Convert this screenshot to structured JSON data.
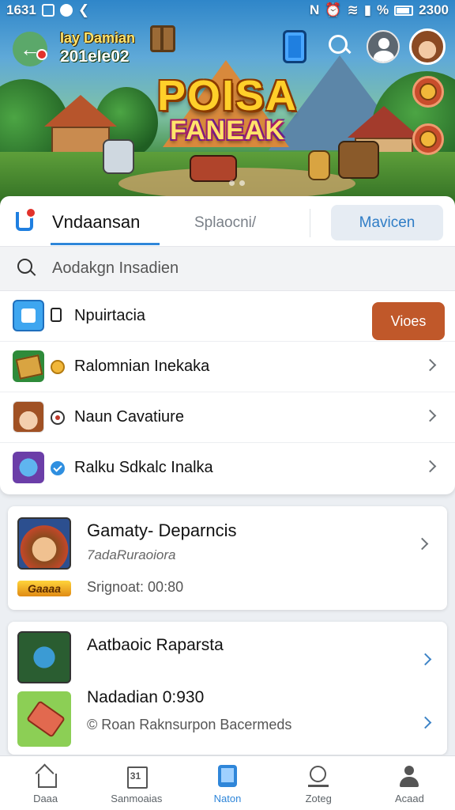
{
  "status_bar": {
    "time": "1631",
    "right_text": "2300"
  },
  "hero": {
    "title": "Iay Damian",
    "subtitle": "201eIe02",
    "logo_line1": "POISA",
    "logo_line2": "FANEAK",
    "icons": [
      "back-icon",
      "chest-icon",
      "phone-icon",
      "search-icon",
      "profile-icon",
      "avatar",
      "badge-icon"
    ]
  },
  "tabs": {
    "active": "Vndaansan",
    "inactive": "Splaocni/",
    "button": "Mavicen"
  },
  "search": {
    "placeholder": "Aodakgn Insadien"
  },
  "list": {
    "rows": [
      {
        "label": "Npuirtacia",
        "action": "Vioes"
      },
      {
        "label": "Ralomnian Inekaka"
      },
      {
        "label": "Naun Cavatiure"
      },
      {
        "label": "Ralku Sdkalc Inalka"
      }
    ]
  },
  "card2": {
    "title": "Gamaty- Deparncis",
    "subtitle": "7adaRuraoiora",
    "meta": "Srignoat: 00:80",
    "badge": "Gaaaa"
  },
  "card3": {
    "title": "Aatbaoic Raparsta",
    "title2": "Nadadian 0:930",
    "meta": "© Roan Raknsurpon Bacermeds"
  },
  "bottom_nav": {
    "items": [
      {
        "label": "Daaa",
        "icon": "home-icon"
      },
      {
        "label": "Sanmoaias",
        "icon": "calendar-icon"
      },
      {
        "label": "Naton",
        "icon": "tablet-icon",
        "active": true
      },
      {
        "label": "Zoteg",
        "icon": "search-icon"
      },
      {
        "label": "Acaad",
        "icon": "user-icon"
      }
    ]
  },
  "colors": {
    "accent": "#2f86d9",
    "action_button": "#c0582a",
    "notification": "#e2322b"
  }
}
